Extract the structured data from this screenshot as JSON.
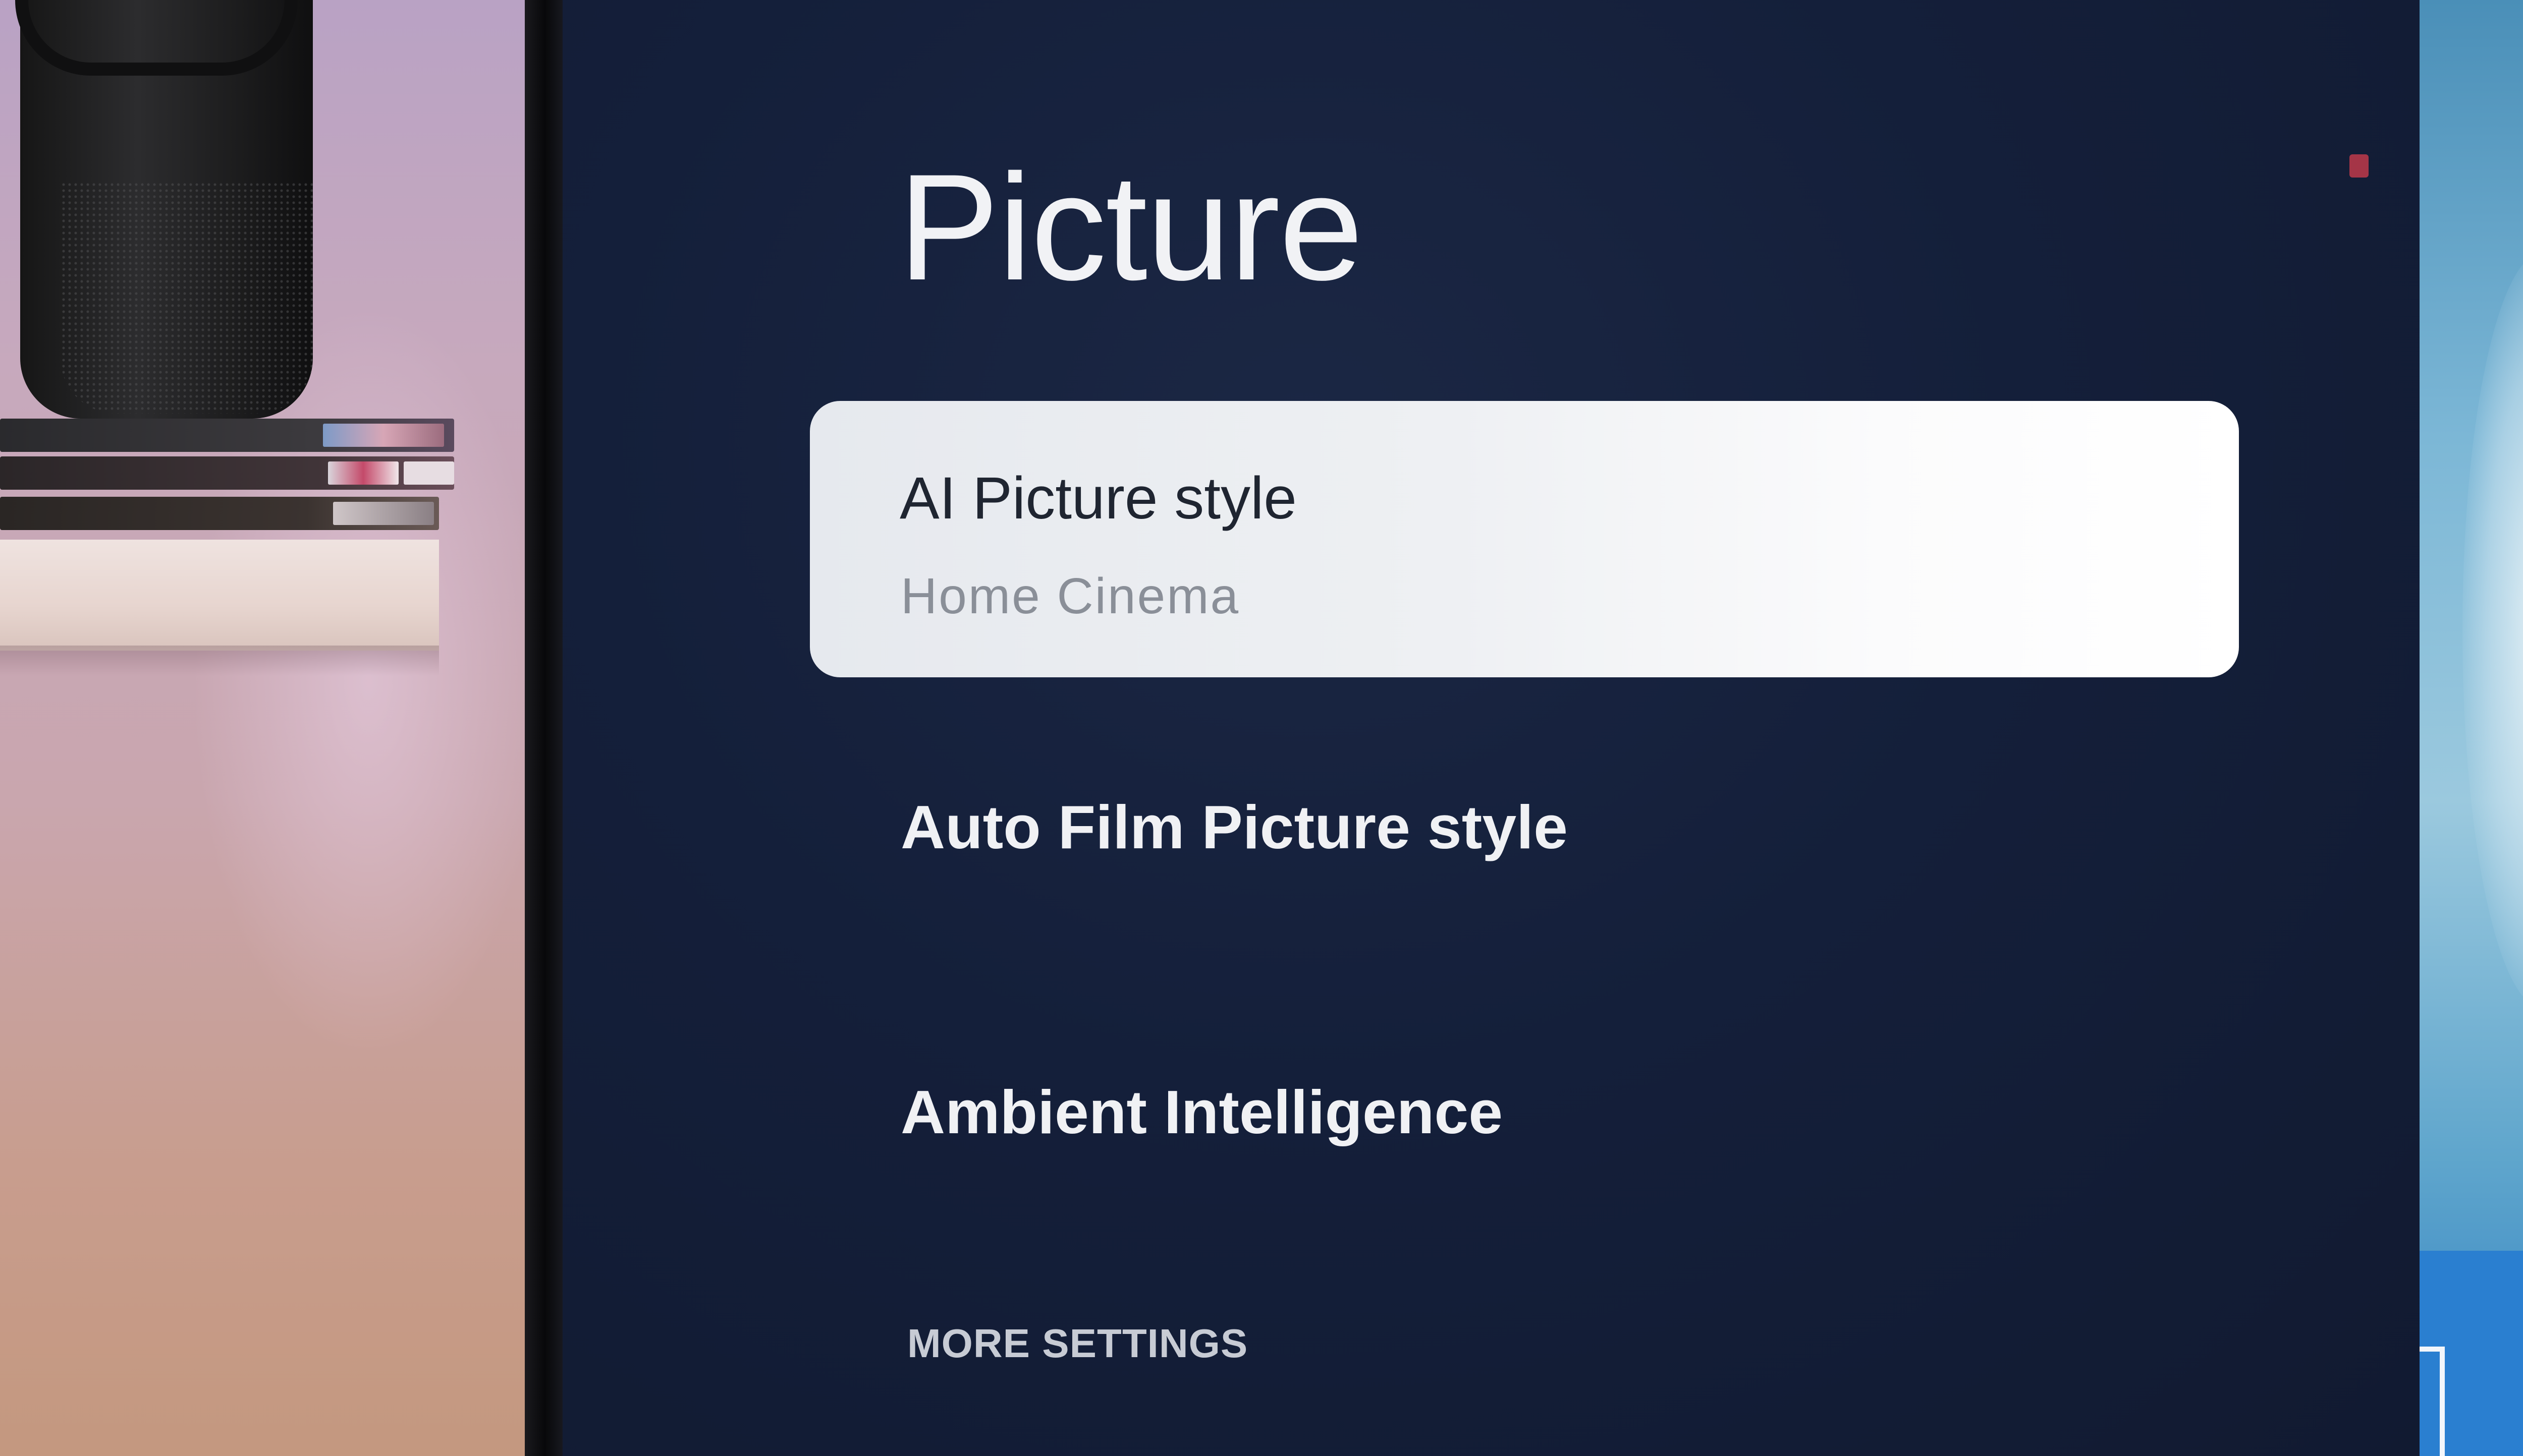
{
  "screen": {
    "title": "Picture",
    "menu": {
      "selected_item": {
        "label": "AI Picture style",
        "value": "Home Cinema"
      },
      "items": [
        {
          "label": "Auto Film Picture style"
        },
        {
          "label": "Ambient Intelligence"
        }
      ],
      "more_settings_label": "MORE SETTINGS"
    }
  },
  "colors": {
    "screen_background": "#141f3a",
    "selected_item_background": "#f2f3f6",
    "selected_item_text": "#1f2531",
    "selected_item_value_text": "#8a8f98",
    "menu_text": "#f0f1f4",
    "more_settings_text": "#c7cbd4"
  }
}
